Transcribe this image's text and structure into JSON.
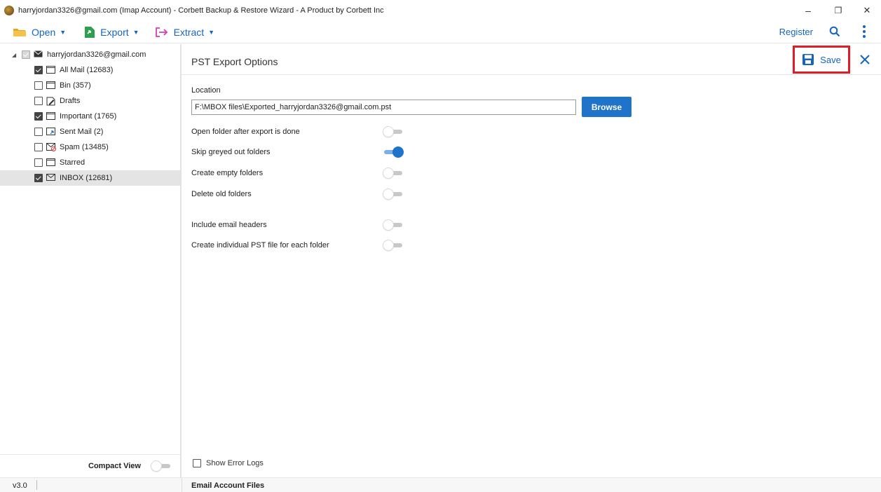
{
  "window": {
    "title": "harryjordan3326@gmail.com (Imap Account) - Corbett Backup & Restore Wizard - A Product by Corbett Inc",
    "minimize": "–",
    "restore": "❐",
    "close": "✕"
  },
  "toolbar": {
    "open_label": "Open",
    "export_label": "Export",
    "extract_label": "Extract",
    "register_label": "Register"
  },
  "tree": {
    "account": "harryjordan3326@gmail.com",
    "folders": [
      {
        "name": "All Mail",
        "count": "(12683)",
        "checked": true
      },
      {
        "name": "Bin",
        "count": "(357)",
        "checked": false
      },
      {
        "name": "Drafts",
        "count": "",
        "checked": false
      },
      {
        "name": "Important",
        "count": "(1765)",
        "checked": true
      },
      {
        "name": "Sent Mail",
        "count": "(2)",
        "checked": false
      },
      {
        "name": "Spam",
        "count": "(13485)",
        "checked": false
      },
      {
        "name": "Starred",
        "count": "",
        "checked": false
      },
      {
        "name": "INBOX",
        "count": "(12681)",
        "checked": true,
        "selected": true
      }
    ]
  },
  "compact_view": {
    "label": "Compact View",
    "on": false
  },
  "main": {
    "title": "PST Export Options",
    "save_label": "Save",
    "location_label": "Location",
    "location_value": "F:\\MBOX files\\Exported_harryjordan3326@gmail.com.pst",
    "browse_label": "Browse",
    "options": [
      {
        "label": "Open folder after export is done",
        "on": false
      },
      {
        "label": "Skip greyed out folders",
        "on": true
      },
      {
        "label": "Create empty folders",
        "on": false
      },
      {
        "label": "Delete old folders",
        "on": false
      },
      {
        "label": "Include email headers",
        "on": false
      },
      {
        "label": "Create individual PST file for each folder",
        "on": false
      }
    ],
    "show_error_logs_label": "Show Error Logs"
  },
  "status": {
    "version": "v3.0",
    "section": "Email Account Files"
  },
  "colors": {
    "accent": "#1f73c9",
    "link_blue": "#1565c0",
    "highlight_red": "#e21c24"
  }
}
